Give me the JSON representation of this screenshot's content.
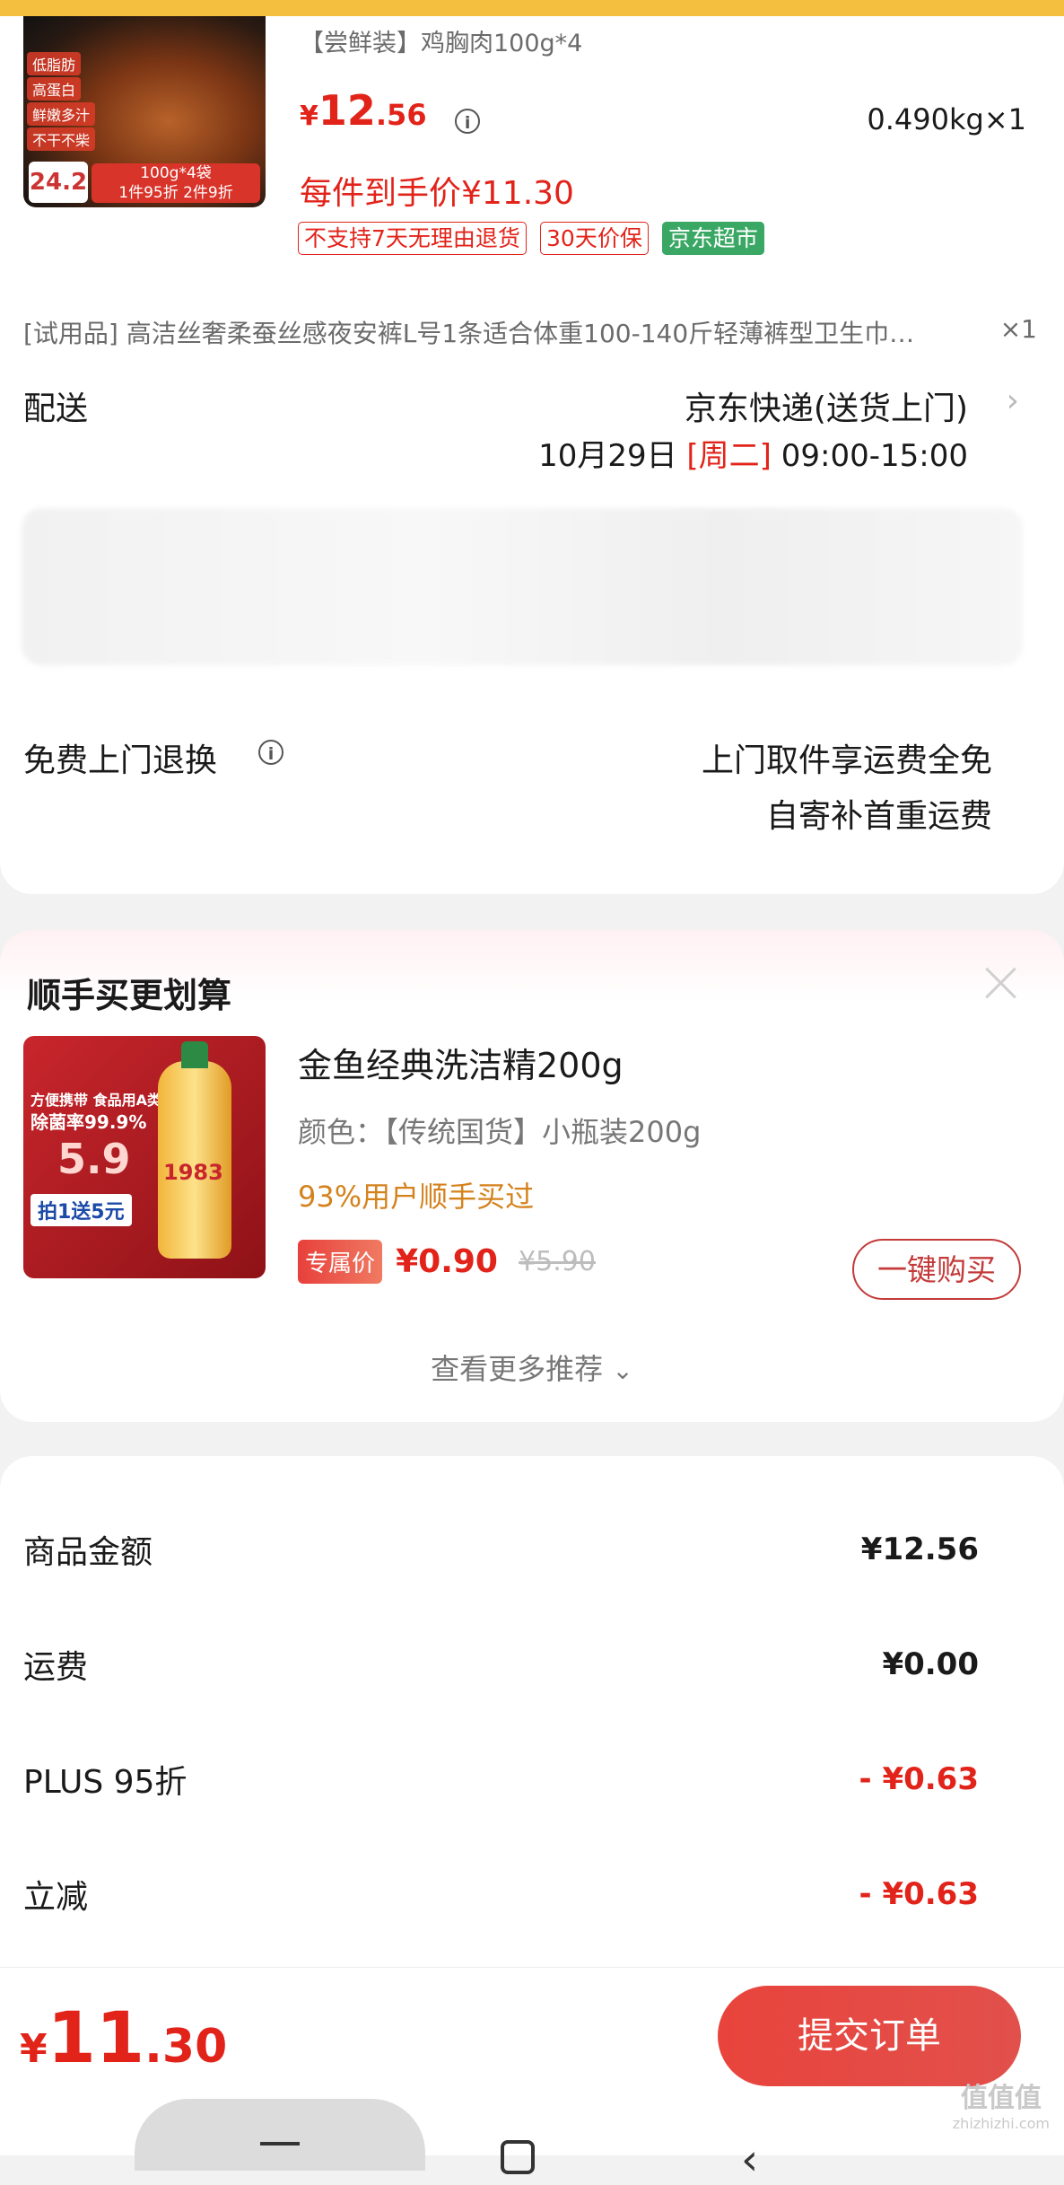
{
  "product": {
    "title": "【尝鲜装】鸡胸肉100g*4",
    "price_currency": "¥",
    "price_int": "12",
    "price_dec": ".56",
    "weight_qty": "0.490kg×1",
    "hand_price": "每件到手价¥11.30",
    "badges": [
      "不支持7天无理由退货",
      "30天价保",
      "京东超市"
    ],
    "thumb_tags": [
      "低脂肪",
      "高蛋白",
      "鲜嫩多汁",
      "不干不柴"
    ],
    "thumb_price": "24.2",
    "thumb_pack": "100g*4袋",
    "thumb_promo": "1件95折 2件9折"
  },
  "trial": {
    "text": "[试用品]  高洁丝奢柔蚕丝感夜安裤L号1条适合体重100-140斤轻薄裤型卫生巾…",
    "qty": "×1"
  },
  "delivery": {
    "label": "配送",
    "method": "京东快递(送货上门)",
    "date": "10月29日",
    "weekday": "[周二]",
    "time": "09:00-15:00"
  },
  "returns": {
    "label": "免费上门退换",
    "line1": "上门取件享运费全免",
    "line2": "自寄补首重运费"
  },
  "addon": {
    "section_title": "顺手买更划算",
    "name": "金鱼经典洗洁精200g",
    "variant": "颜色：【传统国货】小瓶装200g",
    "stat": "93%用户顺手买过",
    "exclusive_label": "专属价",
    "price": "¥0.90",
    "orig_price": "¥5.90",
    "buy_button": "一键购买",
    "more": "查看更多推荐",
    "thumb_line1": "方便携带 食品用A类",
    "thumb_line2": "除菌率99.9%",
    "thumb_price": "5.9",
    "thumb_promo": "拍1送5元",
    "thumb_year": "1983"
  },
  "summary": {
    "rows": [
      {
        "label": "商品金额",
        "value": "¥12.56"
      },
      {
        "label": "运费",
        "value": "¥0.00"
      },
      {
        "label": "PLUS 95折",
        "value": "- ¥0.63"
      },
      {
        "label": "立减",
        "value": "- ¥0.63"
      }
    ]
  },
  "footer": {
    "total_currency": "¥",
    "total_int": "11",
    "total_dec": ".30",
    "submit": "提交订单",
    "watermark_top": "值值值",
    "watermark_bottom": "zhizhizhi.com"
  },
  "colors": {
    "accent": "#e2231a",
    "header": "#f4bf3f",
    "market_green": "#3aa864"
  }
}
